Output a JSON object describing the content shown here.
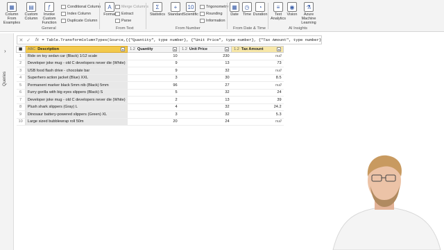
{
  "ribbon": {
    "groups": {
      "general": "General",
      "from_text": "From Text",
      "from_number": "From Number",
      "from_date_time": "From Date & Time",
      "ai_insights": "AI Insights"
    },
    "column_from_examples": "Column From Examples",
    "custom_column": "Custom Column",
    "invoke_custom_function": "Invoke Custom Function",
    "conditional_column": "Conditional Column",
    "index_column": "Index Column",
    "duplicate_column": "Duplicate Column",
    "format": "Format",
    "merge_columns": "Merge Columns",
    "extract": "Extract",
    "parse": "Parse",
    "statistics": "Statistics",
    "standard": "Standard",
    "scientific": "Scientific",
    "trigonometry": "Trigonometry",
    "rounding": "Rounding",
    "information": "Information",
    "date": "Date",
    "time": "Time",
    "duration": "Duration",
    "text_analytics": "Text Analytics",
    "vision": "Vision",
    "azure_ml": "Azure Machine Learning"
  },
  "formula_bar": {
    "formula": "= Table.TransformColumnTypes(Source,{{\"Quantity\", type number}, {\"Unit Price\", type number}, {\"Tax Amount\", type number}})"
  },
  "queries_pane": {
    "label": "Queries"
  },
  "table": {
    "columns": [
      {
        "type": "ABC",
        "name": "Description"
      },
      {
        "type": "1.2",
        "name": "Quantity"
      },
      {
        "type": "1.2",
        "name": "Unit Price"
      },
      {
        "type": "1.2",
        "name": "Tax Amount"
      }
    ],
    "rows": [
      [
        "1",
        "Ride on toy sedan car (Black) 1/12 scale",
        "10",
        "230",
        "null"
      ],
      [
        "2",
        "Developer joke mug - old C developers never die (White)",
        "9",
        "13",
        "73"
      ],
      [
        "3",
        "USB food flash drive - chocolate bar",
        "9",
        "32",
        "null"
      ],
      [
        "4",
        "Superhero action jacket (Blue) XXL",
        "3",
        "30",
        "8.5"
      ],
      [
        "5",
        "Permanent marker black 5mm nib (Black) 5mm",
        "96",
        "27",
        "null"
      ],
      [
        "6",
        "Furry gorilla with big eyes slippers (Black) S",
        "5",
        "32",
        "24"
      ],
      [
        "7",
        "Developer joke mug - old C developers never die (White)",
        "2",
        "13",
        "39"
      ],
      [
        "8",
        "Plush shark slippers (Gray) L",
        "4",
        "32",
        "24.2"
      ],
      [
        "9",
        "Dinosaur battery-powered slippers (Green) XL",
        "3",
        "32",
        "5.3"
      ],
      [
        "10",
        "Large sized bubblewrap roll 50m",
        "20",
        "24",
        "null"
      ]
    ]
  }
}
